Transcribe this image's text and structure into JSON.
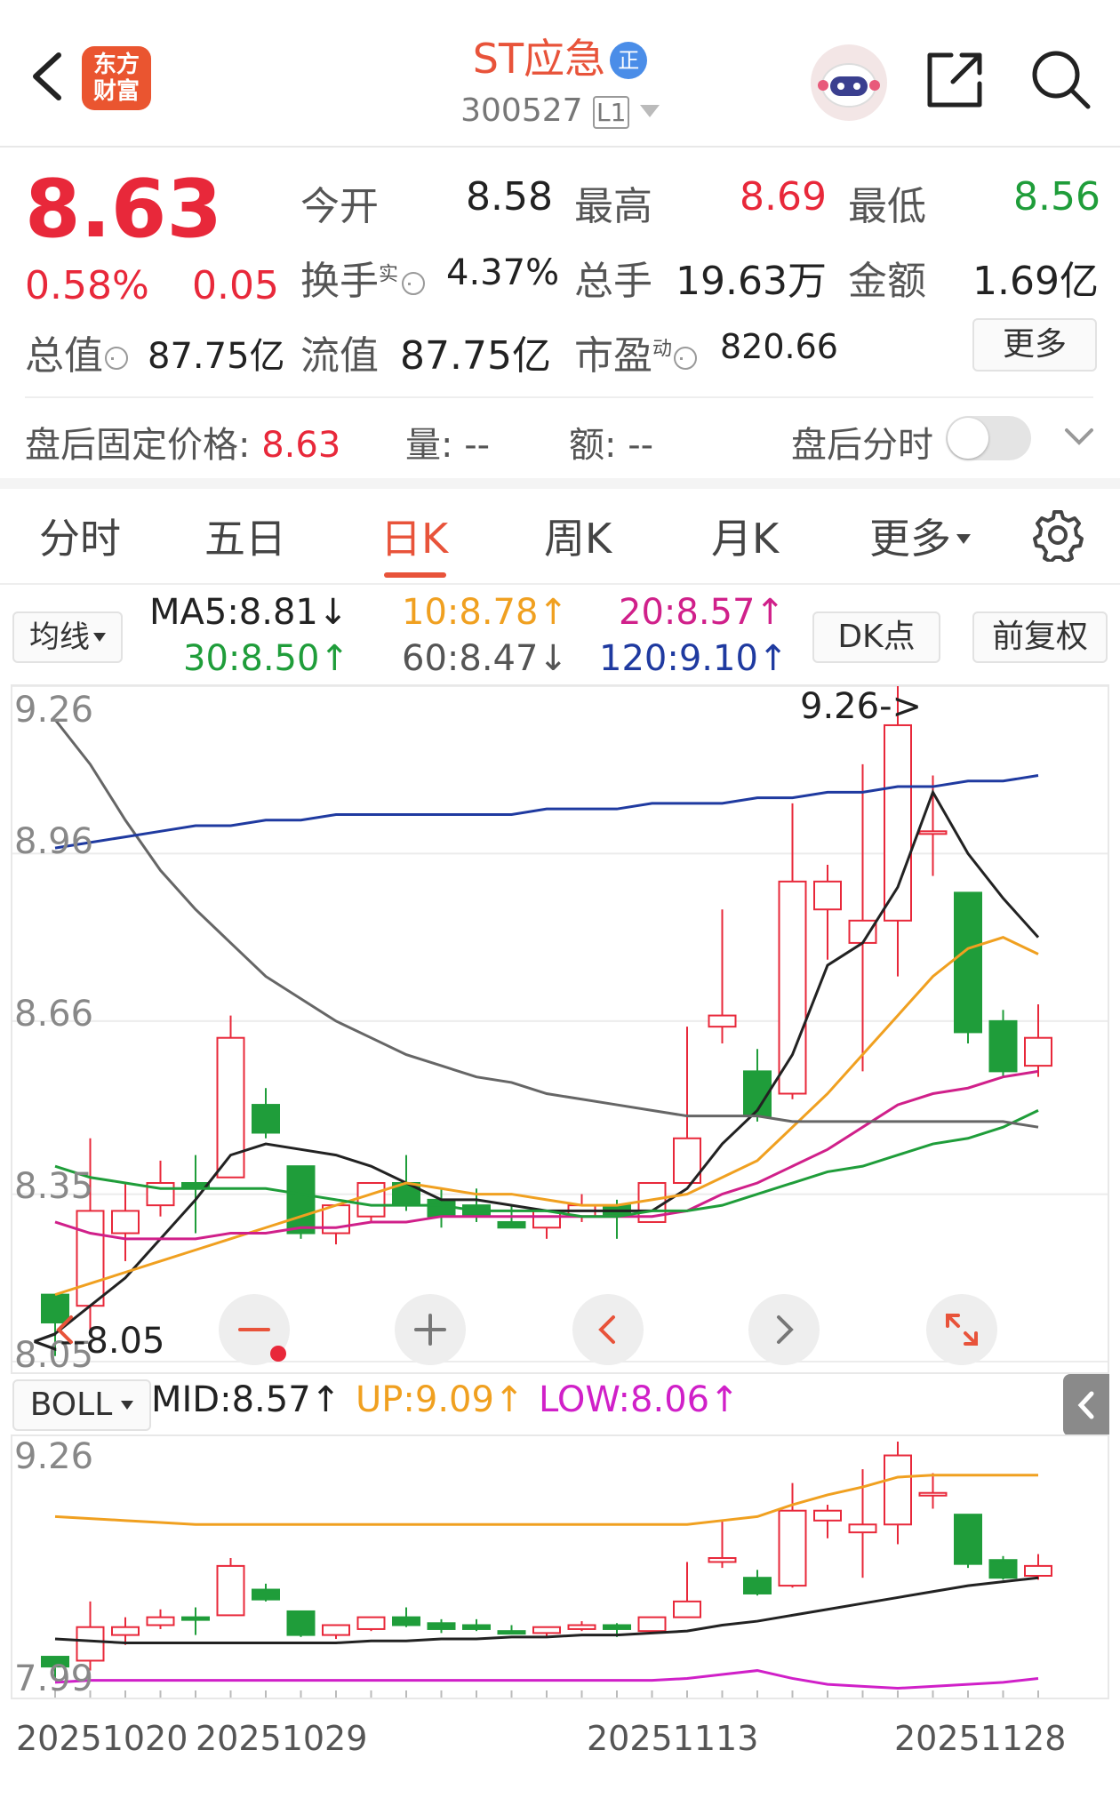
{
  "header": {
    "brand_line1": "东方",
    "brand_line2": "财富",
    "stock_name": "ST应急",
    "name_badge": "正",
    "stock_code": "300527",
    "level": "L1"
  },
  "quote": {
    "price": "8.63",
    "change_pct": "0.58%",
    "change": "0.05",
    "open_label": "今开",
    "open": "8.58",
    "high_label": "最高",
    "high": "8.69",
    "low_label": "最低",
    "low": "8.56",
    "turnover_label": "换手",
    "turnover_sup": "实",
    "turnover": "4.37%",
    "volume_label": "总手",
    "volume": "19.63万",
    "amount_label": "金额",
    "amount": "1.69亿",
    "mktcap_label": "总值",
    "mktcap": "87.75亿",
    "float_label": "流值",
    "float": "87.75亿",
    "pe_label": "市盈",
    "pe_sup": "动",
    "pe": "820.66",
    "more_label": "更多"
  },
  "after_hours": {
    "fixed_price_label": "盘后固定价格:",
    "fixed_price": "8.63",
    "vol_label": "量: --",
    "amt_label": "额: --",
    "timeshare_label": "盘后分时"
  },
  "tabs": [
    {
      "label": "分时"
    },
    {
      "label": "五日"
    },
    {
      "label": "日K"
    },
    {
      "label": "周K"
    },
    {
      "label": "月K"
    },
    {
      "label": "更多"
    }
  ],
  "ma_bar": {
    "selector": "均线",
    "ma5": "MA5:8.81↓",
    "ma10": "10:8.78↑",
    "ma20": "20:8.57↑",
    "ma30": "30:8.50↑",
    "ma60": "60:8.47↓",
    "ma120": "120:9.10↑",
    "dk_label": "DK点",
    "adjust_label": "前复权"
  },
  "colors": {
    "up": "#e8283a",
    "down": "#1f9d3a",
    "ma5": "#222222",
    "ma10": "#f0a020",
    "ma20": "#d0208a",
    "ma30": "#1f9d3a",
    "ma60": "#666666",
    "ma120": "#1f3aa0"
  },
  "chart_data": {
    "type": "candlestick",
    "y_ticks": [
      "9.26",
      "8.96",
      "8.66",
      "8.35",
      "8.05"
    ],
    "ylim": [
      8.05,
      9.26
    ],
    "max_label": "9.26->",
    "min_label": "<--8.05",
    "candles": [
      {
        "o": 8.17,
        "h": 8.17,
        "l": 8.06,
        "c": 8.12
      },
      {
        "o": 8.15,
        "h": 8.45,
        "l": 8.1,
        "c": 8.32
      },
      {
        "o": 8.28,
        "h": 8.37,
        "l": 8.23,
        "c": 8.32
      },
      {
        "o": 8.33,
        "h": 8.41,
        "l": 8.31,
        "c": 8.37
      },
      {
        "o": 8.37,
        "h": 8.42,
        "l": 8.28,
        "c": 8.36
      },
      {
        "o": 8.38,
        "h": 8.67,
        "l": 8.38,
        "c": 8.63
      },
      {
        "o": 8.51,
        "h": 8.54,
        "l": 8.45,
        "c": 8.46
      },
      {
        "o": 8.4,
        "h": 8.4,
        "l": 8.27,
        "c": 8.28
      },
      {
        "o": 8.28,
        "h": 8.33,
        "l": 8.26,
        "c": 8.33
      },
      {
        "o": 8.31,
        "h": 8.37,
        "l": 8.3,
        "c": 8.37
      },
      {
        "o": 8.37,
        "h": 8.42,
        "l": 8.32,
        "c": 8.33
      },
      {
        "o": 8.34,
        "h": 8.36,
        "l": 8.29,
        "c": 8.31
      },
      {
        "o": 8.33,
        "h": 8.36,
        "l": 8.3,
        "c": 8.31
      },
      {
        "o": 8.3,
        "h": 8.33,
        "l": 8.29,
        "c": 8.29
      },
      {
        "o": 8.29,
        "h": 8.32,
        "l": 8.27,
        "c": 8.32
      },
      {
        "o": 8.31,
        "h": 8.35,
        "l": 8.3,
        "c": 8.33
      },
      {
        "o": 8.33,
        "h": 8.34,
        "l": 8.27,
        "c": 8.31
      },
      {
        "o": 8.3,
        "h": 8.37,
        "l": 8.3,
        "c": 8.37
      },
      {
        "o": 8.37,
        "h": 8.65,
        "l": 8.37,
        "c": 8.45
      },
      {
        "o": 8.65,
        "h": 8.86,
        "l": 8.62,
        "c": 8.67
      },
      {
        "o": 8.57,
        "h": 8.61,
        "l": 8.48,
        "c": 8.49
      },
      {
        "o": 8.53,
        "h": 9.05,
        "l": 8.52,
        "c": 8.91
      },
      {
        "o": 8.86,
        "h": 8.94,
        "l": 8.77,
        "c": 8.91
      },
      {
        "o": 8.8,
        "h": 9.12,
        "l": 8.57,
        "c": 8.84
      },
      {
        "o": 8.84,
        "h": 9.26,
        "l": 8.74,
        "c": 9.19
      },
      {
        "o": 9.0,
        "h": 9.1,
        "l": 8.92,
        "c": 9.0
      },
      {
        "o": 8.89,
        "h": 8.89,
        "l": 8.62,
        "c": 8.64
      },
      {
        "o": 8.66,
        "h": 8.68,
        "l": 8.56,
        "c": 8.57
      },
      {
        "o": 8.58,
        "h": 8.69,
        "l": 8.56,
        "c": 8.63
      }
    ],
    "ma_lines": {
      "ma5": [
        8.1,
        8.15,
        8.2,
        8.27,
        8.34,
        8.42,
        8.44,
        8.43,
        8.42,
        8.4,
        8.37,
        8.34,
        8.34,
        8.33,
        8.32,
        8.32,
        8.32,
        8.32,
        8.36,
        8.44,
        8.5,
        8.6,
        8.76,
        8.8,
        8.9,
        9.07,
        8.96,
        8.88,
        8.81
      ],
      "ma10": [
        8.17,
        8.19,
        8.21,
        8.23,
        8.25,
        8.27,
        8.29,
        8.31,
        8.33,
        8.35,
        8.37,
        8.36,
        8.35,
        8.35,
        8.34,
        8.33,
        8.33,
        8.34,
        8.35,
        8.38,
        8.41,
        8.47,
        8.53,
        8.6,
        8.67,
        8.74,
        8.79,
        8.81,
        8.78
      ],
      "ma20": [
        8.3,
        8.28,
        8.27,
        8.27,
        8.27,
        8.28,
        8.28,
        8.29,
        8.29,
        8.3,
        8.3,
        8.31,
        8.31,
        8.31,
        8.31,
        8.31,
        8.31,
        8.31,
        8.32,
        8.35,
        8.37,
        8.4,
        8.43,
        8.47,
        8.51,
        8.53,
        8.54,
        8.56,
        8.57
      ],
      "ma30": [
        8.4,
        8.38,
        8.37,
        8.36,
        8.36,
        8.36,
        8.36,
        8.35,
        8.34,
        8.33,
        8.33,
        8.33,
        8.32,
        8.32,
        8.32,
        8.31,
        8.31,
        8.32,
        8.32,
        8.33,
        8.35,
        8.37,
        8.39,
        8.4,
        8.42,
        8.44,
        8.45,
        8.47,
        8.5
      ],
      "ma60": [
        9.2,
        9.12,
        9.02,
        8.93,
        8.86,
        8.8,
        8.74,
        8.7,
        8.66,
        8.63,
        8.6,
        8.58,
        8.56,
        8.55,
        8.53,
        8.52,
        8.51,
        8.5,
        8.49,
        8.49,
        8.49,
        8.48,
        8.48,
        8.48,
        8.48,
        8.48,
        8.48,
        8.48,
        8.47
      ],
      "ma120": [
        8.97,
        8.98,
        8.99,
        9.0,
        9.01,
        9.01,
        9.02,
        9.02,
        9.03,
        9.03,
        9.03,
        9.03,
        9.03,
        9.03,
        9.04,
        9.04,
        9.04,
        9.05,
        9.05,
        9.05,
        9.06,
        9.06,
        9.07,
        9.07,
        9.08,
        9.08,
        9.09,
        9.09,
        9.1
      ]
    },
    "boll": {
      "selector": "BOLL",
      "mid": "MID:8.57↑",
      "up": "UP:9.09↑",
      "low": "LOW:8.06↑",
      "y_ticks": [
        "9.26",
        "7.99"
      ],
      "ylim": [
        7.99,
        9.26
      ],
      "up_line": [
        8.88,
        8.87,
        8.86,
        8.85,
        8.84,
        8.84,
        8.84,
        8.84,
        8.84,
        8.84,
        8.84,
        8.84,
        8.84,
        8.84,
        8.84,
        8.84,
        8.84,
        8.84,
        8.84,
        8.86,
        8.88,
        8.94,
        8.99,
        9.03,
        9.08,
        9.09,
        9.09,
        9.09,
        9.09
      ],
      "mid_line": [
        8.26,
        8.25,
        8.24,
        8.24,
        8.24,
        8.24,
        8.24,
        8.24,
        8.24,
        8.25,
        8.25,
        8.26,
        8.26,
        8.27,
        8.27,
        8.28,
        8.28,
        8.29,
        8.3,
        8.33,
        8.35,
        8.38,
        8.41,
        8.44,
        8.47,
        8.5,
        8.53,
        8.55,
        8.57
      ],
      "low_line": [
        8.04,
        8.05,
        8.05,
        8.05,
        8.05,
        8.05,
        8.05,
        8.05,
        8.05,
        8.05,
        8.05,
        8.05,
        8.05,
        8.05,
        8.05,
        8.05,
        8.05,
        8.05,
        8.06,
        8.08,
        8.1,
        8.06,
        8.03,
        8.02,
        8.01,
        8.02,
        8.03,
        8.04,
        8.06
      ]
    },
    "x_labels": [
      "20251020",
      "20251029",
      "20251113",
      "20251128"
    ],
    "x_label_index": [
      0,
      5,
      16,
      26
    ]
  }
}
